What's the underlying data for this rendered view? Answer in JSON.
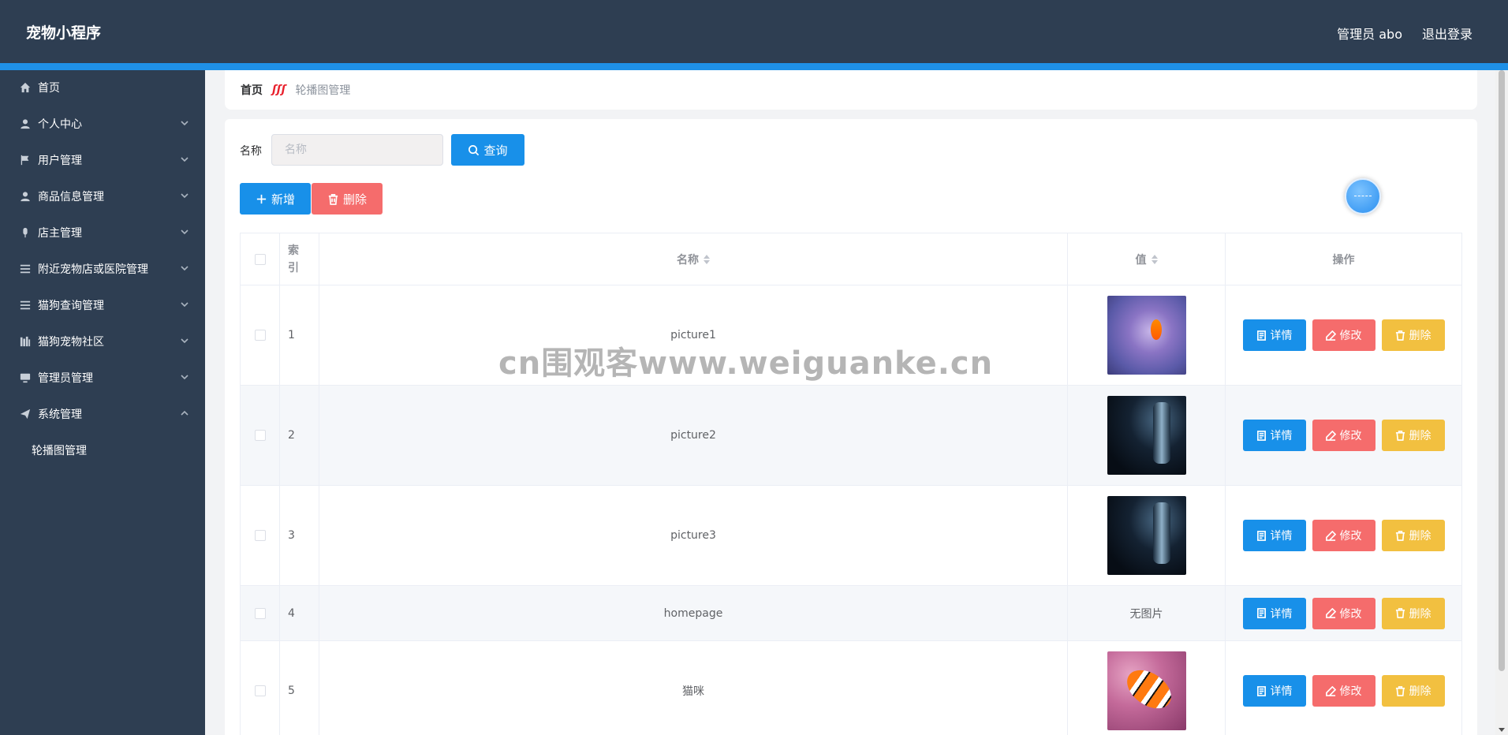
{
  "header": {
    "brand": "宠物小程序",
    "admin_label": "管理员 abo",
    "logout_label": "退出登录"
  },
  "sidebar": {
    "items": [
      {
        "label": "首页",
        "icon": "home-icon",
        "has_arrow": false
      },
      {
        "label": "个人中心",
        "icon": "user-icon",
        "has_arrow": true
      },
      {
        "label": "用户管理",
        "icon": "flag-icon",
        "has_arrow": true
      },
      {
        "label": "商品信息管理",
        "icon": "user-icon",
        "has_arrow": true
      },
      {
        "label": "店主管理",
        "icon": "mic-icon",
        "has_arrow": true
      },
      {
        "label": "附近宠物店或医院管理",
        "icon": "list-icon",
        "has_arrow": true
      },
      {
        "label": "猫狗查询管理",
        "icon": "list-icon",
        "has_arrow": true
      },
      {
        "label": "猫狗宠物社区",
        "icon": "books-icon",
        "has_arrow": true
      },
      {
        "label": "管理员管理",
        "icon": "monitor-icon",
        "has_arrow": true
      },
      {
        "label": "系统管理",
        "icon": "send-icon",
        "has_arrow": true,
        "expanded": true
      }
    ],
    "subitems": [
      {
        "label": "轮播图管理"
      }
    ]
  },
  "breadcrumb": {
    "home": "首页",
    "current": "轮播图管理"
  },
  "search": {
    "label": "名称",
    "placeholder": "名称",
    "query_button": "查询"
  },
  "actions": {
    "add_button": "新增",
    "delete_button": "删除"
  },
  "table": {
    "headers": {
      "index": "索引",
      "name": "名称",
      "value": "值",
      "operations": "操作"
    },
    "rows": [
      {
        "index": "1",
        "name": "picture1",
        "value_type": "image",
        "image": "purple-fish"
      },
      {
        "index": "2",
        "name": "picture2",
        "value_type": "image",
        "image": "dark-abstract"
      },
      {
        "index": "3",
        "name": "picture3",
        "value_type": "image",
        "image": "dark-abstract"
      },
      {
        "index": "4",
        "name": "homepage",
        "value_type": "text",
        "value_text": "无图片"
      },
      {
        "index": "5",
        "name": "猫咪",
        "value_type": "image",
        "image": "clownfish"
      }
    ],
    "row_buttons": {
      "detail": "详情",
      "edit": "修改",
      "remove": "删除"
    }
  },
  "watermark": "cn围观客www.weiguanke.cn",
  "colors": {
    "header_bg": "#2e3e52",
    "accent_bar": "#1f90e6",
    "primary": "#1890e9",
    "danger": "#f56c6c",
    "warning": "#f2c040"
  }
}
